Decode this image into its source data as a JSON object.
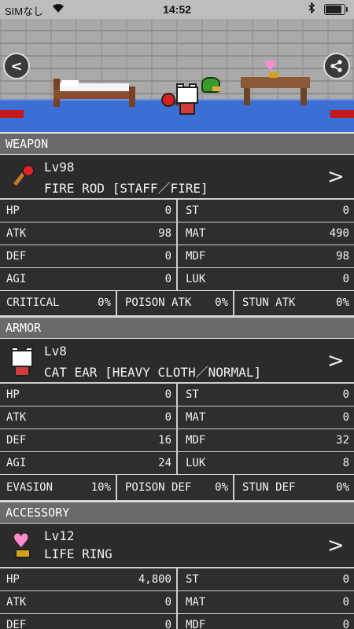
{
  "status_bar": {
    "carrier": "SIMなし",
    "time": "14:52",
    "battery_level": 0.95
  },
  "scene": {
    "back_label": "<"
  },
  "sections": {
    "weapon": {
      "header": "WEAPON",
      "level": "Lv98",
      "name": "FIRE ROD [STAFF／FIRE]",
      "stats": [
        [
          "HP",
          "0",
          "ST",
          "0"
        ],
        [
          "ATK",
          "98",
          "MAT",
          "490"
        ],
        [
          "DEF",
          "0",
          "MDF",
          "98"
        ],
        [
          "AGI",
          "0",
          "LUK",
          "0"
        ]
      ],
      "extra": [
        [
          "CRITICAL",
          "0%"
        ],
        [
          "POISON ATK",
          "0%"
        ],
        [
          "STUN ATK",
          "0%"
        ]
      ]
    },
    "armor": {
      "header": "ARMOR",
      "level": "Lv8",
      "name": "CAT EAR [HEAVY CLOTH／NORMAL]",
      "stats": [
        [
          "HP",
          "0",
          "ST",
          "0"
        ],
        [
          "ATK",
          "0",
          "MAT",
          "0"
        ],
        [
          "DEF",
          "16",
          "MDF",
          "32"
        ],
        [
          "AGI",
          "24",
          "LUK",
          "8"
        ]
      ],
      "extra": [
        [
          "EVASION",
          "10%"
        ],
        [
          "POISON DEF",
          "0%"
        ],
        [
          "STUN DEF",
          "0%"
        ]
      ]
    },
    "accessory": {
      "header": "ACCESSORY",
      "level": "Lv12",
      "name": "LIFE RING",
      "stats": [
        [
          "HP",
          "4,800",
          "ST",
          "0"
        ],
        [
          "ATK",
          "0",
          "MAT",
          "0"
        ],
        [
          "DEF",
          "0",
          "MDF",
          "0"
        ]
      ]
    }
  },
  "colors": {
    "section_header": "#6a6a6a",
    "background": "#2e2e2e",
    "floor": "#3c6fd3",
    "rug": "#c21a1a"
  },
  "icons": {
    "back": "chevron-left-icon",
    "share": "share-icon",
    "row_chevron": "chevron-right-icon"
  }
}
